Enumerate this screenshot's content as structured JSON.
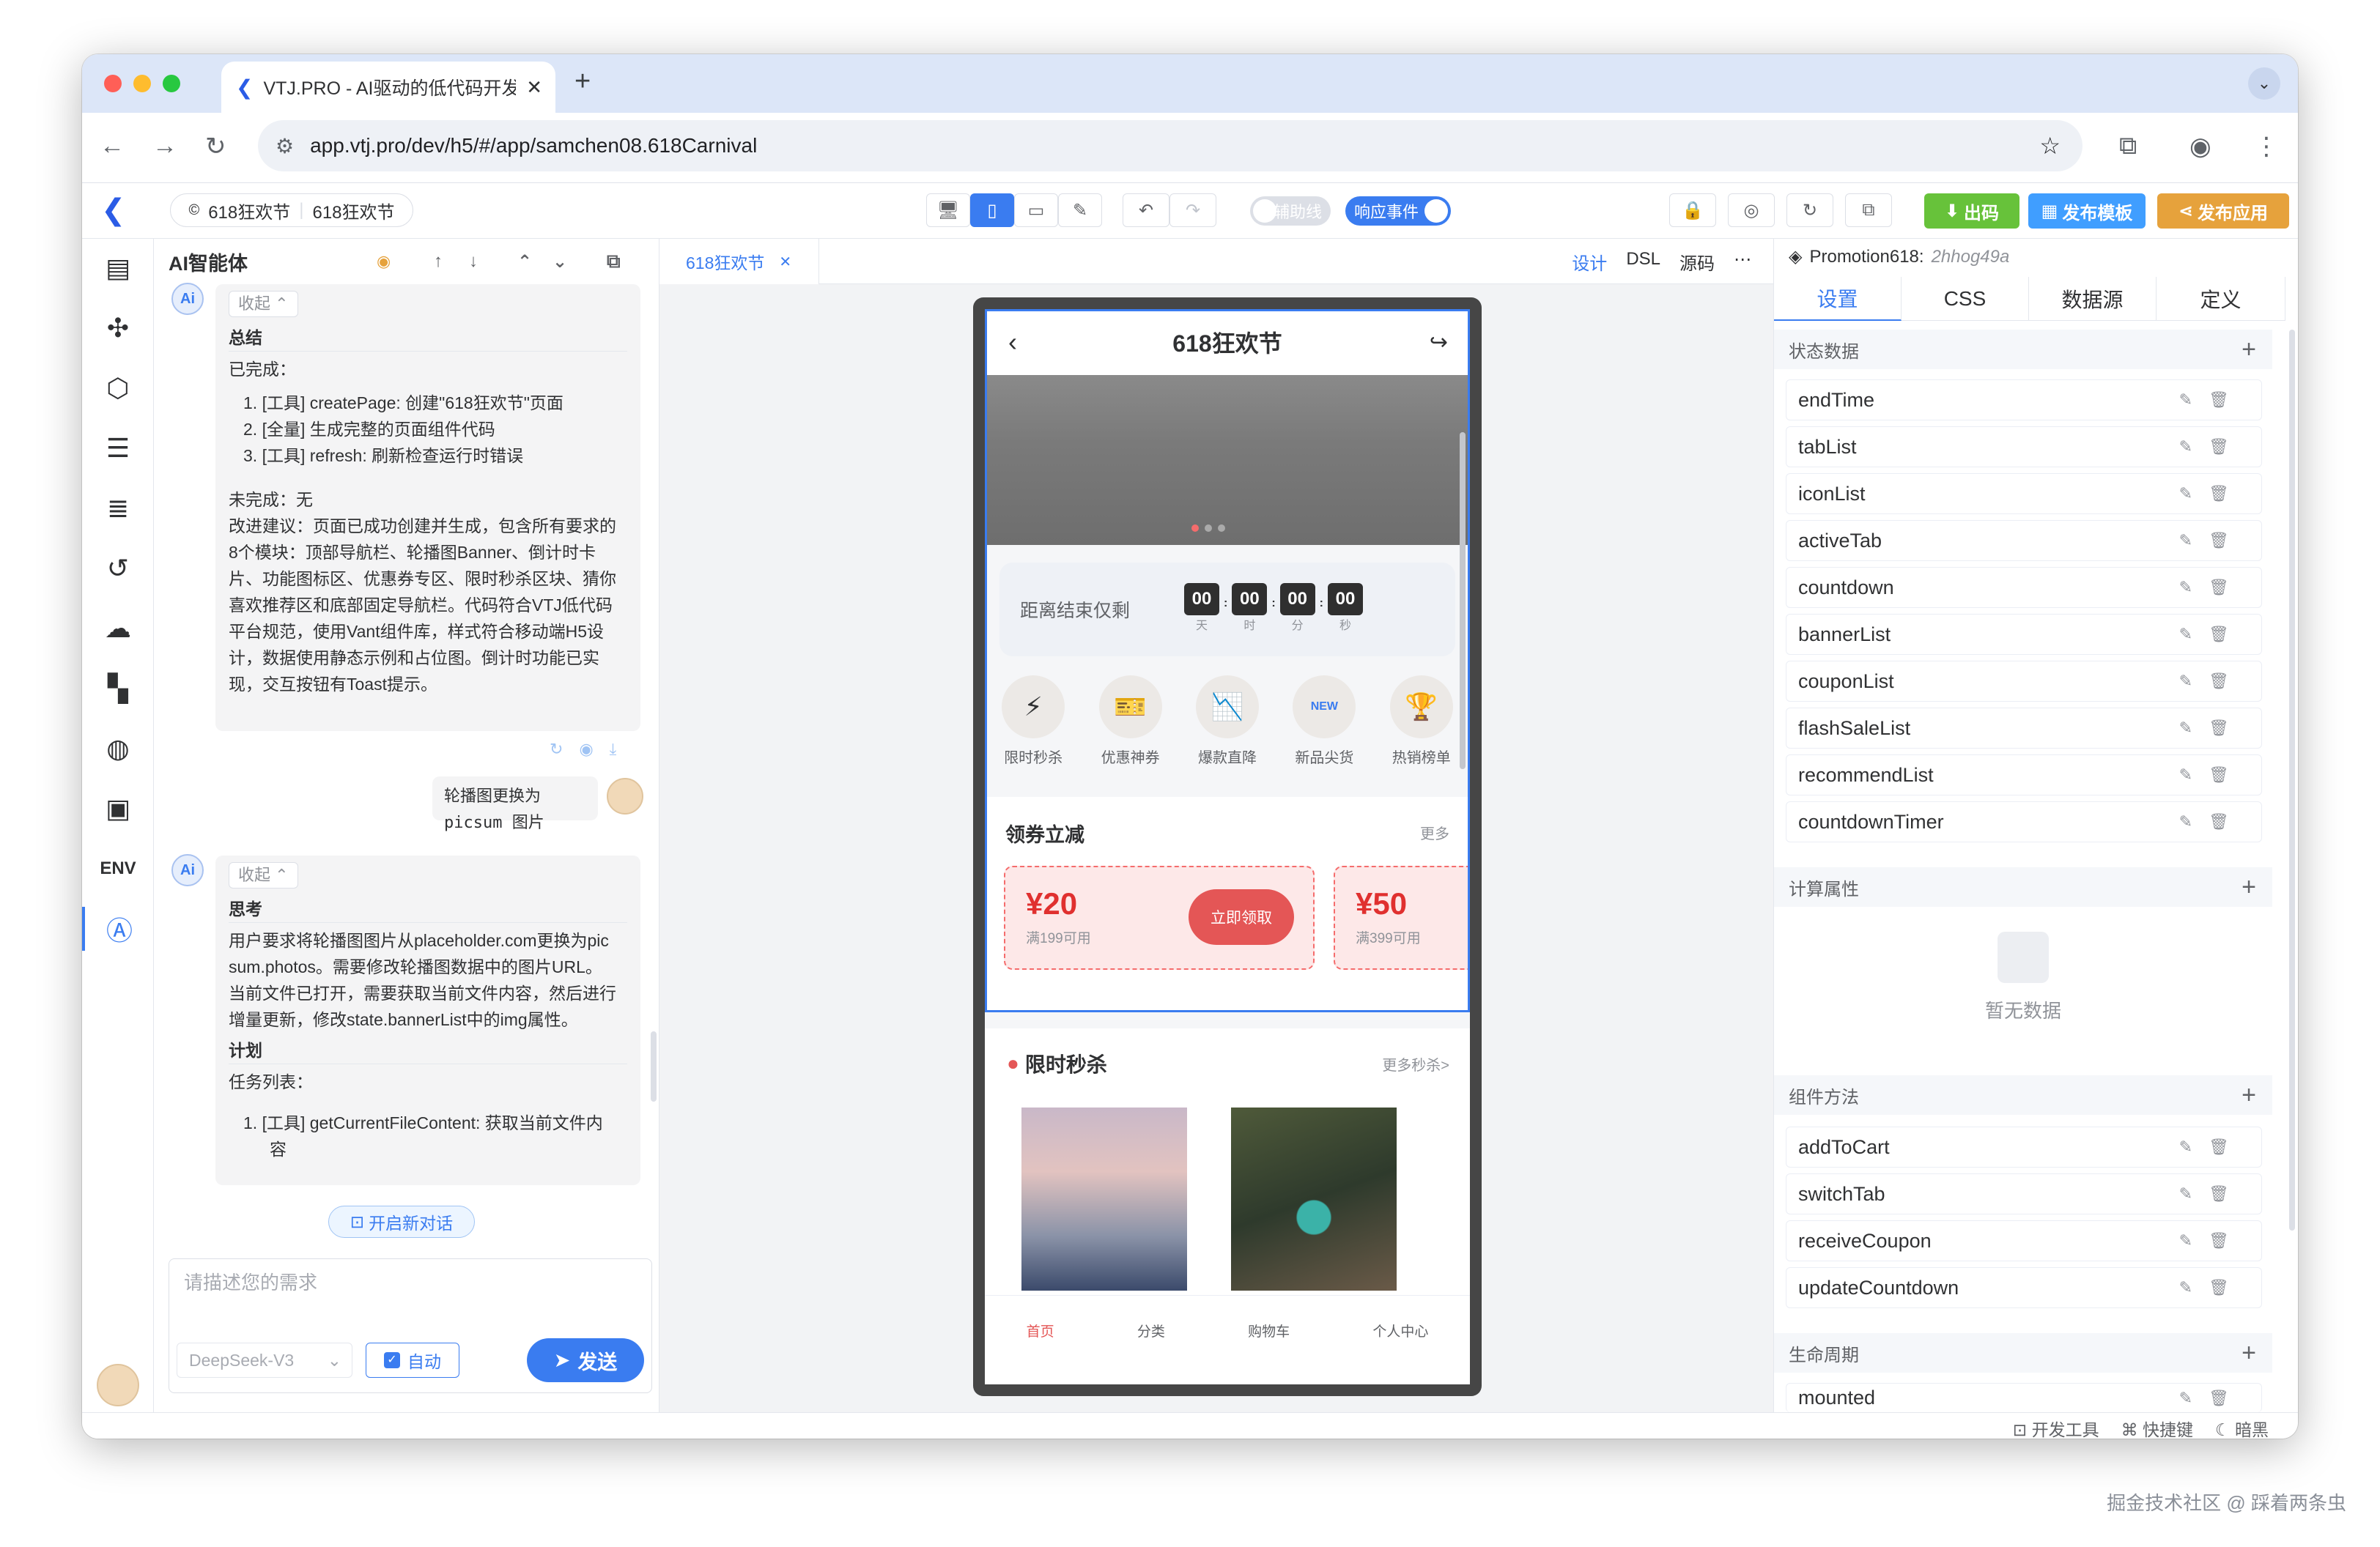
{
  "browser": {
    "tab_title": "VTJ.PRO - AI驱动的低代码开发",
    "url": "app.vtj.pro/dev/h5/#/app/samchen08.618Carnival"
  },
  "toolbar": {
    "project_name": "618狂欢节",
    "page_name": "618狂欢节",
    "aux_line": "辅助线",
    "response_events": "响应事件",
    "export_code": "出码",
    "publish_template": "发布模板",
    "publish_app": "发布应用"
  },
  "ai_panel": {
    "title": "AI智能体",
    "fold": "收起",
    "msg1": {
      "section": "总结",
      "lines": [
        "已完成：",
        "1. [工具] createPage: 创建\"618狂欢节\"页面",
        "2. [全量] 生成完整的页面组件代码",
        "3. [工具] refresh: 刷新检查运行时错误",
        "未完成：无",
        "改进建议：页面已成功创建并生成，包含所有要求的",
        "8个模块：顶部导航栏、轮播图Banner、倒计时卡",
        "片、功能图标区、优惠券专区、限时秒杀区块、猜你",
        "喜欢推荐区和底部固定导航栏。代码符合VTJ低代码",
        "平台规范，使用Vant组件库，样式符合移动端H5设",
        "计，数据使用静态示例和占位图。倒计时功能已实",
        "现，交互按钮有Toast提示。"
      ]
    },
    "user_msg": "轮播图更换为 picsum 图片",
    "msg2": {
      "section1": "思考",
      "think_lines": [
        "用户要求将轮播图图片从placeholder.com更换为pic",
        "sum.photos。需要修改轮播图数据中的图片URL。",
        "当前文件已打开，需要获取当前文件内容，然后进行",
        "增量更新，修改state.bannerList中的img属性。"
      ],
      "section2": "计划",
      "plan_lines": [
        "任务列表：",
        "1. [工具] getCurrentFileContent: 获取当前文件内",
        "容"
      ]
    },
    "new_chat": "开启新对话",
    "input_placeholder": "请描述您的需求",
    "model": "DeepSeek-V3",
    "auto": "自动",
    "send": "发送"
  },
  "canvas": {
    "doc_tab": "618狂欢节",
    "view_modes": [
      "设计",
      "DSL",
      "源码"
    ],
    "phone": {
      "nav_title": "618狂欢节",
      "countdown_label": "距离结束仅剩",
      "countdown": [
        {
          "value": "00",
          "unit": "天"
        },
        {
          "value": "00",
          "unit": "时"
        },
        {
          "value": "00",
          "unit": "分"
        },
        {
          "value": "00",
          "unit": "秒"
        }
      ],
      "icons": [
        {
          "label": "限时秒杀",
          "glyph": "⚡"
        },
        {
          "label": "优惠神券",
          "glyph": "🎫"
        },
        {
          "label": "爆款直降",
          "glyph": "📉"
        },
        {
          "label": "新品尖货",
          "glyph": "NEW"
        },
        {
          "label": "热销榜单",
          "glyph": "🏆"
        }
      ],
      "coupon_title": "领券立减",
      "coupon_more": "更多",
      "coupons": [
        {
          "amount": "¥20",
          "cond": "满199可用",
          "btn": "立即领取"
        },
        {
          "amount": "¥50",
          "cond": "满399可用"
        }
      ],
      "flash_title": "限时秒杀",
      "flash_more": "更多秒杀>",
      "tabbar": [
        "首页",
        "分类",
        "购物车",
        "个人中心"
      ]
    }
  },
  "right_panel": {
    "component": "Promotion618:",
    "component_id": "2hhog49a",
    "tabs": [
      "设置",
      "CSS",
      "数据源",
      "定义"
    ],
    "state_title": "状态数据",
    "state": [
      "endTime",
      "tabList",
      "iconList",
      "activeTab",
      "countdown",
      "bannerList",
      "couponList",
      "flashSaleList",
      "recommendList",
      "countdownTimer"
    ],
    "computed_title": "计算属性",
    "empty": "暂无数据",
    "methods_title": "组件方法",
    "methods": [
      "addToCart",
      "switchTab",
      "receiveCoupon",
      "updateCountdown"
    ],
    "lifecycle_title": "生命周期",
    "lifecycle": [
      "mounted"
    ]
  },
  "statusbar": {
    "devtools": "开发工具",
    "shortcuts": "快捷键",
    "dark": "暗黑"
  },
  "watermark": "掘金技术社区 @ 踩着两条虫"
}
